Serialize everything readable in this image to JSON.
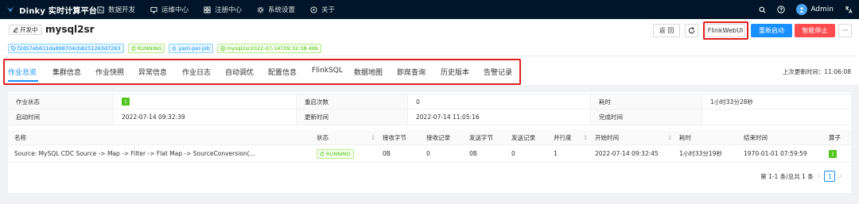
{
  "app": {
    "title": "Dinky 实时计算平台"
  },
  "nav": {
    "items": [
      {
        "label": "数据开发",
        "icon": "code-icon"
      },
      {
        "label": "运维中心",
        "icon": "desktop-icon"
      },
      {
        "label": "注册中心",
        "icon": "appstore-icon"
      },
      {
        "label": "系统设置",
        "icon": "gear-icon"
      },
      {
        "label": "关于",
        "icon": "info-icon"
      }
    ]
  },
  "user": {
    "name": "Admin"
  },
  "job": {
    "status": "开发中",
    "name": "mysql2sr",
    "id": "f2d57eb611da898704cb8251263d7263",
    "state": "RUNNING",
    "mode": "yarn-per-job",
    "instance": "mysql2sr2022-07-14T09:32:38.496"
  },
  "actions": {
    "back": "返 回",
    "flink_web_ui": "FlinkWebUI",
    "restart": "重新启动",
    "smart_stop": "智能停止",
    "more": "···"
  },
  "tabs": [
    "作业总览",
    "集群信息",
    "作业快照",
    "异常信息",
    "作业日志",
    "自动调优",
    "配置信息",
    "FlinkSQL",
    "数据地图",
    "即席查询",
    "历史版本",
    "告警记录"
  ],
  "last_update": "上次更新时间：11:06:08",
  "desc": {
    "job_status_label": "作业状态",
    "job_status_value": "1",
    "restart_label": "重启次数",
    "restart_value": "0",
    "duration_label": "耗时",
    "duration_value": "1小时33分28秒",
    "start_label": "启动时间",
    "start_value": "2022-07-14 09:32:39",
    "update_label": "更新时间",
    "update_value": "2022-07-14 11:05:16",
    "finish_label": "完成时间",
    "finish_value": ""
  },
  "table": {
    "headers": [
      "名称",
      "状态",
      "接收字节",
      "接收记录",
      "发送字节",
      "发送记录",
      "并行度",
      "开始时间",
      "耗时",
      "结束时间",
      "算子"
    ],
    "rows": [
      [
        "Source: MySQL CDC Source -> Map -> Filter -> Flat Map -> SourceConversion(...",
        "RUNNING",
        "0B",
        "0",
        "0B",
        "0",
        "1",
        "2022-07-14 09:32:45",
        "1小时33分19秒",
        "1970-01-01 07:59:59",
        "1"
      ]
    ]
  },
  "pagination": {
    "summary": "第 1-1 条/总共 1 条",
    "current": "1"
  },
  "colors": {
    "primary": "#1890ff",
    "danger": "#ff4d4f",
    "success": "#52c41a",
    "header_bg": "#001529",
    "highlight": "#e02020"
  }
}
